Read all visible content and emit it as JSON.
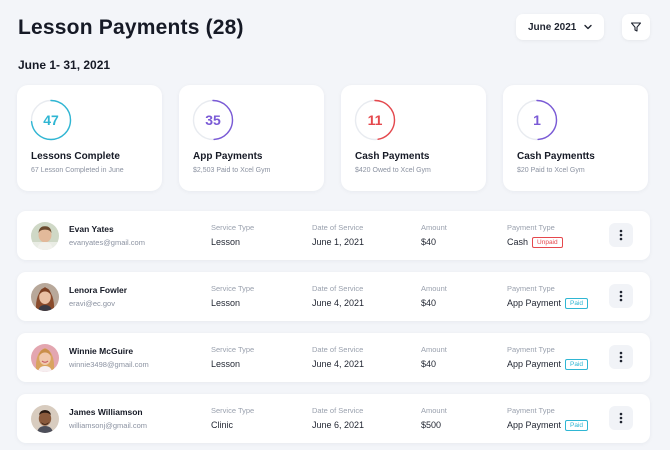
{
  "header": {
    "title": "Lesson Payments (28)",
    "month_selected": "June 2021"
  },
  "date_range": "June 1- 31, 2021",
  "stats": [
    {
      "value": "47",
      "label": "Lessons Complete",
      "sub": "67 Lesson Completed in June",
      "color": "#2fb6d3"
    },
    {
      "value": "35",
      "label": "App Payments",
      "sub": "$2,503 Paid to Xcel Gym",
      "color": "#7a5ad6"
    },
    {
      "value": "11",
      "label": "Cash Payments",
      "sub": "$420 Owed to Xcel Gym",
      "color": "#e5484d"
    },
    {
      "value": "1",
      "label": "Cash Paymentts",
      "sub": "$20 Paid to Xcel Gym",
      "color": "#7a5ad6"
    }
  ],
  "columns": {
    "service_type": "Service Type",
    "date_of_service": "Date of Service",
    "amount": "Amount",
    "payment_type": "Payment Type"
  },
  "rows": [
    {
      "name": "Evan Yates",
      "email": "evanyates@gmail.com",
      "service": "Lesson",
      "date": "June 1, 2021",
      "amount": "$40",
      "payment": "Cash",
      "status": "Unpaid",
      "avatar_icon": "avatar-man-1"
    },
    {
      "name": "Lenora Fowler",
      "email": "eravi@ec.gov",
      "service": "Lesson",
      "date": "June 4, 2021",
      "amount": "$40",
      "payment": "App Payment",
      "status": "Paid",
      "avatar_icon": "avatar-woman-1"
    },
    {
      "name": "Winnie McGuire",
      "email": "winnie3498@gmail.com",
      "service": "Lesson",
      "date": "June 4, 2021",
      "amount": "$40",
      "payment": "App Payment",
      "status": "Paid",
      "avatar_icon": "avatar-woman-2"
    },
    {
      "name": "James Williamson",
      "email": "williamsonj@gmail.com",
      "service": "Clinic",
      "date": "June 6, 2021",
      "amount": "$500",
      "payment": "App Payment",
      "status": "Paid",
      "avatar_icon": "avatar-man-2"
    }
  ],
  "colors": {
    "paid": "#2fb6d3",
    "unpaid": "#e5484d",
    "background": "#f3f5f9"
  }
}
